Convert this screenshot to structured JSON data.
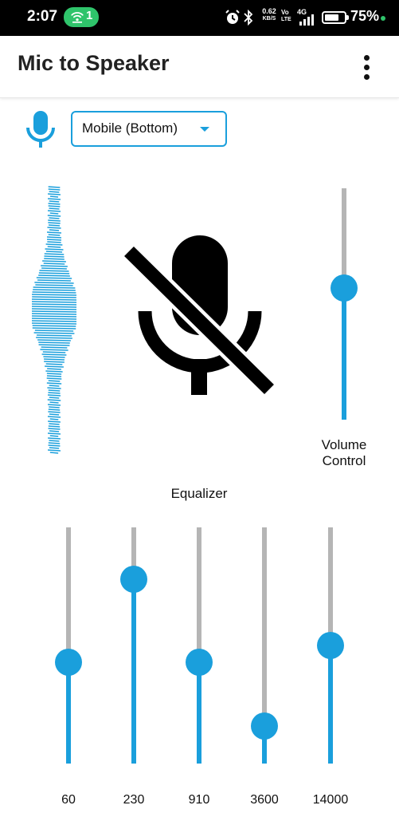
{
  "status_bar": {
    "time": "2:07",
    "hotspot_count": "1",
    "net_speed_value": "0.62",
    "net_speed_unit": "KB/S",
    "volte_top": "Vo",
    "volte_bottom": "LTE",
    "network_type": "4G",
    "battery_percent": "75%",
    "battery_level": 0.75,
    "icons": [
      "hotspot-icon",
      "alarm-icon",
      "bluetooth-icon",
      "signal-icon",
      "battery-icon"
    ]
  },
  "app_bar": {
    "title": "Mic to Speaker",
    "menu_icon": "more-vert-icon"
  },
  "source": {
    "icon": "microphone-icon",
    "selected": "Mobile (Bottom)"
  },
  "player": {
    "waveform_icon": "waveform-icon",
    "mute_icon": "mic-off-icon"
  },
  "volume": {
    "label_line1": "Volume",
    "label_line2": "Control",
    "level": 0.57
  },
  "equalizer": {
    "title": "Equalizer",
    "bands": [
      {
        "label": "60",
        "level": 0.43
      },
      {
        "label": "230",
        "level": 0.78
      },
      {
        "label": "910",
        "level": 0.43
      },
      {
        "label": "3600",
        "level": 0.16
      },
      {
        "label": "14000",
        "level": 0.5
      }
    ]
  },
  "colors": {
    "accent": "#1a9fdc",
    "track_inactive": "#b5b5b5",
    "hotspot_green": "#2fc46b"
  }
}
